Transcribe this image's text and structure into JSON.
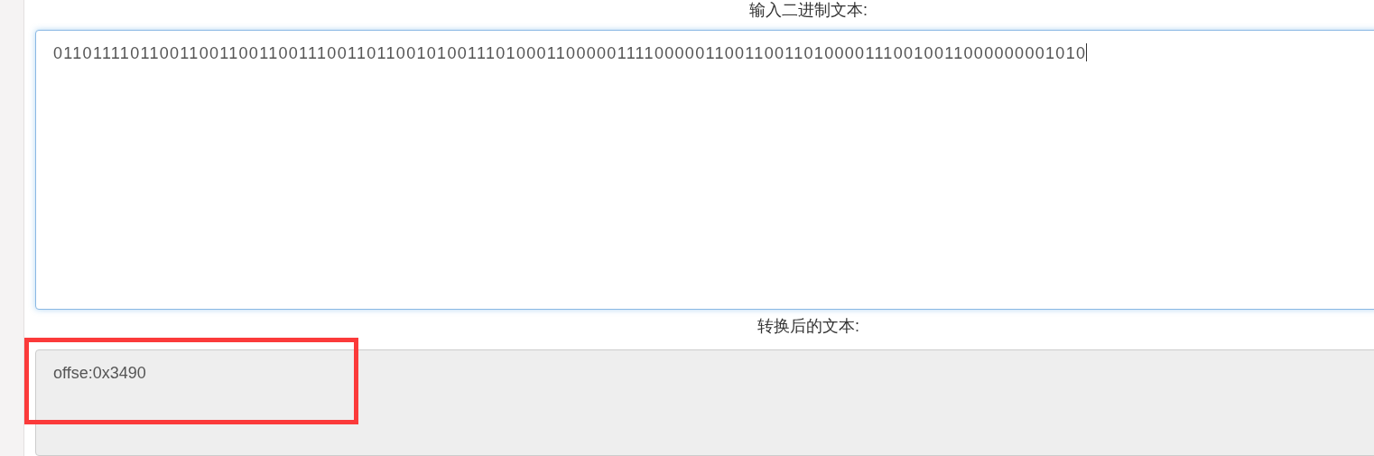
{
  "input_section": {
    "label": "输入二进制文本:",
    "value": "01101111011001100110011001110011011001010011101000110000011110000011001100110100001110010011000000001010"
  },
  "output_section": {
    "label": "转换后的文本:",
    "value": "offse:0x3490"
  }
}
